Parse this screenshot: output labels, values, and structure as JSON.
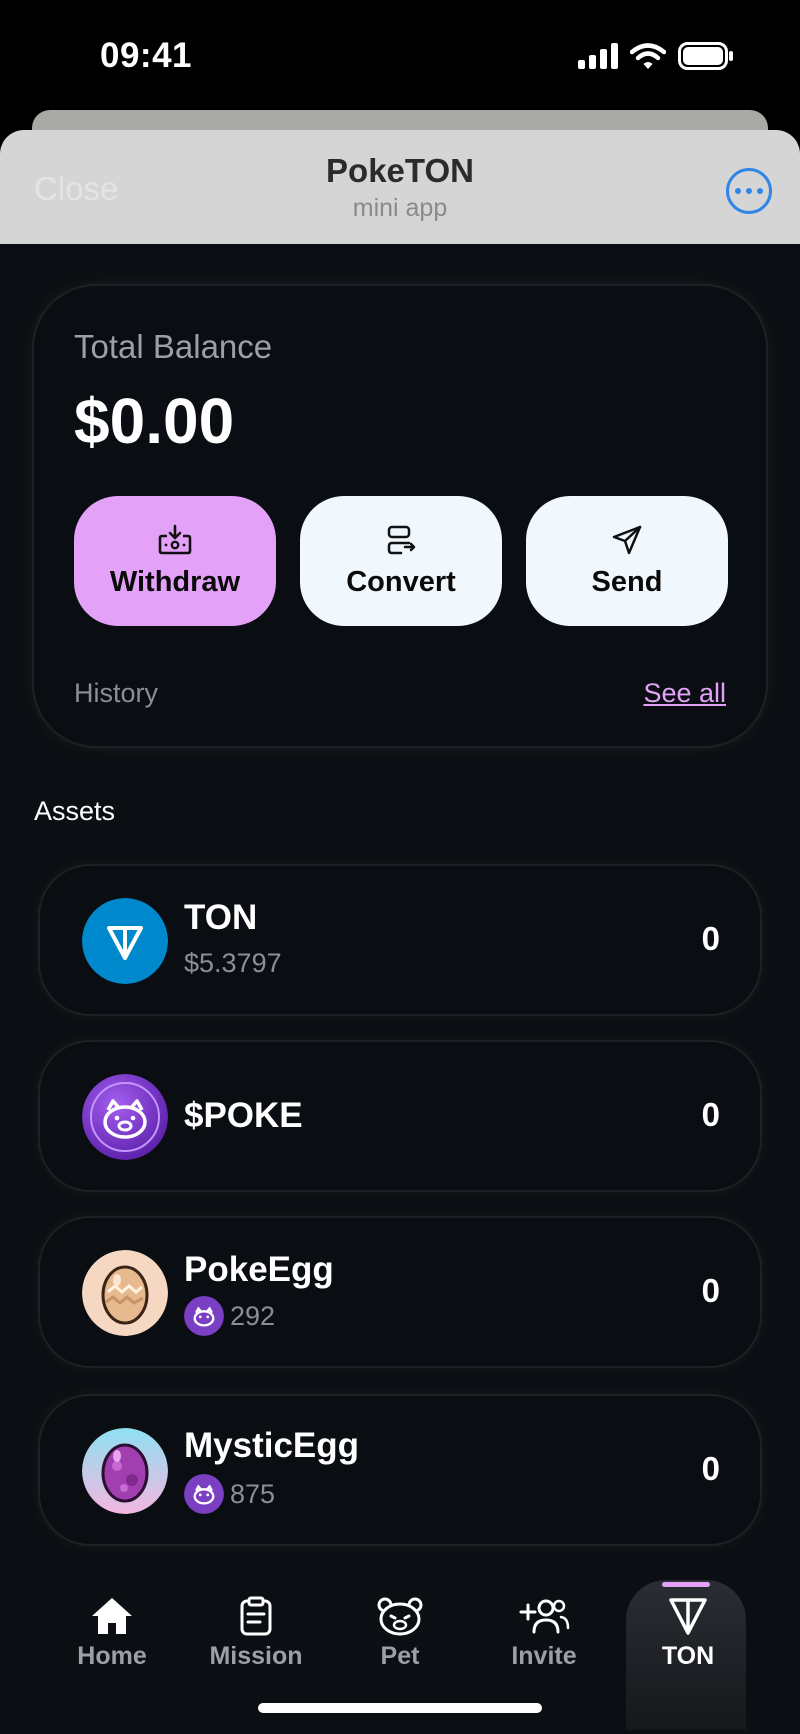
{
  "status_bar": {
    "time": "09:41"
  },
  "header": {
    "close_label": "Close",
    "title": "PokeTON",
    "subtitle": "mini app"
  },
  "balance": {
    "label": "Total Balance",
    "amount": "$0.00",
    "actions": [
      {
        "label": "Withdraw",
        "icon": "withdraw-icon"
      },
      {
        "label": "Convert",
        "icon": "convert-icon"
      },
      {
        "label": "Send",
        "icon": "send-icon"
      }
    ],
    "history_label": "History",
    "see_all_label": "See all"
  },
  "assets": {
    "title": "Assets",
    "items": [
      {
        "name": "TON",
        "sub": "$5.3797",
        "amount": "0",
        "icon": "ton-icon"
      },
      {
        "name": "$POKE",
        "sub": "",
        "amount": "0",
        "icon": "poke-icon"
      },
      {
        "name": "PokeEgg",
        "sub": "292",
        "amount": "0",
        "icon": "poke-egg-icon"
      },
      {
        "name": "MysticEgg",
        "sub": "875",
        "amount": "0",
        "icon": "mystic-egg-icon"
      }
    ]
  },
  "nav": {
    "items": [
      {
        "label": "Home",
        "icon": "home-icon"
      },
      {
        "label": "Mission",
        "icon": "clipboard-icon"
      },
      {
        "label": "Pet",
        "icon": "bear-icon"
      },
      {
        "label": "Invite",
        "icon": "add-user-icon"
      },
      {
        "label": "TON",
        "icon": "ton-icon"
      }
    ],
    "active": "TON"
  },
  "colors": {
    "accent": "#e3a1f7",
    "background": "#0b0e12",
    "header_bg": "#d5d5d5",
    "ton_blue": "#0088cc",
    "poke_purple": "#7b3fc4"
  }
}
